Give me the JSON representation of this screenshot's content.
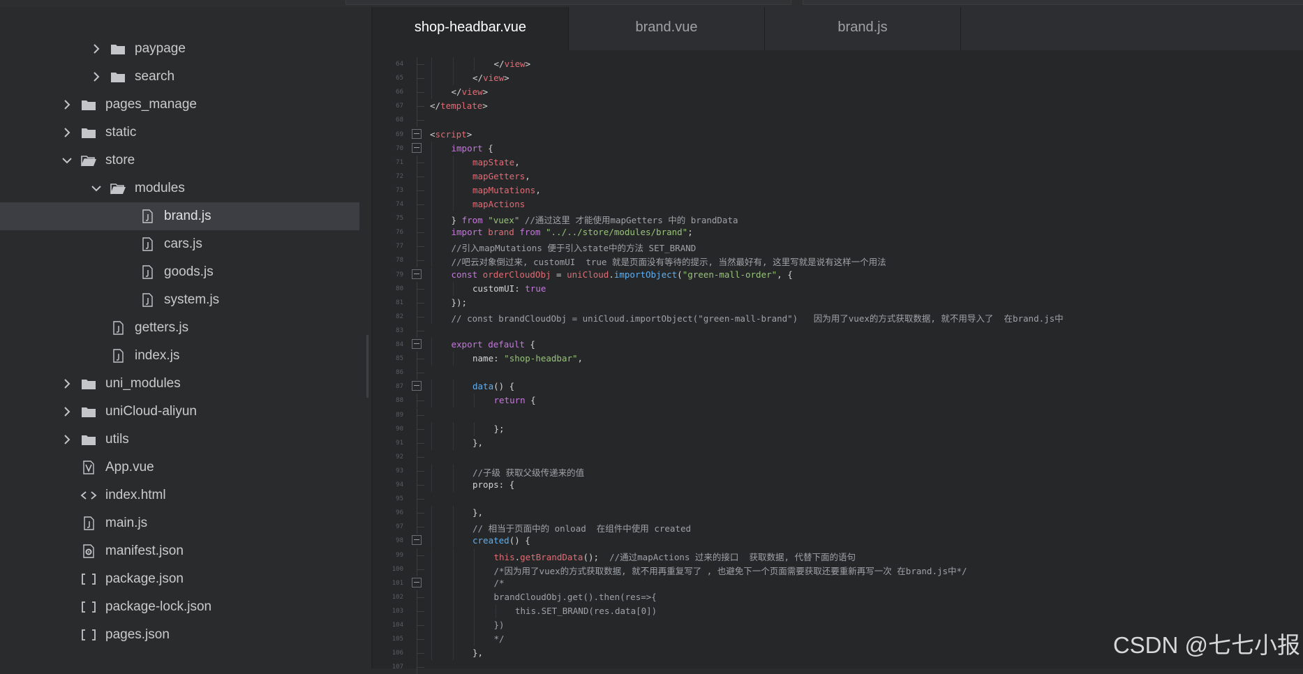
{
  "tabs": [
    {
      "label": "shop-headbar.vue",
      "active": true
    },
    {
      "label": "brand.vue",
      "active": false
    },
    {
      "label": "brand.js",
      "active": false
    }
  ],
  "tree": [
    {
      "label": "paypage",
      "type": "folder",
      "expanded": false,
      "depth": 2,
      "icon": "folder-icon"
    },
    {
      "label": "search",
      "type": "folder",
      "expanded": false,
      "depth": 2,
      "icon": "folder-icon"
    },
    {
      "label": "pages_manage",
      "type": "folder",
      "expanded": false,
      "depth": 1,
      "icon": "folder-icon"
    },
    {
      "label": "static",
      "type": "folder",
      "expanded": false,
      "depth": 1,
      "icon": "folder-icon"
    },
    {
      "label": "store",
      "type": "folder",
      "expanded": true,
      "depth": 1,
      "icon": "folder-open-icon"
    },
    {
      "label": "modules",
      "type": "folder",
      "expanded": true,
      "depth": 2,
      "icon": "folder-open-icon"
    },
    {
      "label": "brand.js",
      "type": "file",
      "depth": 3,
      "icon": "js-file-icon",
      "selected": true
    },
    {
      "label": "cars.js",
      "type": "file",
      "depth": 3,
      "icon": "js-file-icon"
    },
    {
      "label": "goods.js",
      "type": "file",
      "depth": 3,
      "icon": "js-file-icon"
    },
    {
      "label": "system.js",
      "type": "file",
      "depth": 3,
      "icon": "js-file-icon"
    },
    {
      "label": "getters.js",
      "type": "file",
      "depth": 2,
      "icon": "js-file-icon"
    },
    {
      "label": "index.js",
      "type": "file",
      "depth": 2,
      "icon": "js-file-icon"
    },
    {
      "label": "uni_modules",
      "type": "folder",
      "expanded": false,
      "depth": 1,
      "icon": "folder-icon"
    },
    {
      "label": "uniCloud-aliyun",
      "type": "folder",
      "expanded": false,
      "depth": 1,
      "icon": "folder-icon"
    },
    {
      "label": "utils",
      "type": "folder",
      "expanded": false,
      "depth": 1,
      "icon": "folder-icon"
    },
    {
      "label": "App.vue",
      "type": "file",
      "depth": 1,
      "icon": "vue-file-icon"
    },
    {
      "label": "index.html",
      "type": "file",
      "depth": 1,
      "icon": "html-file-icon"
    },
    {
      "label": "main.js",
      "type": "file",
      "depth": 1,
      "icon": "js-file-icon"
    },
    {
      "label": "manifest.json",
      "type": "file",
      "depth": 1,
      "icon": "manifest-file-icon"
    },
    {
      "label": "package.json",
      "type": "file",
      "depth": 1,
      "icon": "json-file-icon"
    },
    {
      "label": "package-lock.json",
      "type": "file",
      "depth": 1,
      "icon": "json-file-icon"
    },
    {
      "label": "pages.json",
      "type": "file",
      "depth": 1,
      "icon": "json-file-icon"
    }
  ],
  "code_lines": [
    {
      "n": "64",
      "indent": 3,
      "fold": false,
      "tokens": [
        {
          "t": "</",
          "c": "p"
        },
        {
          "t": "view",
          "c": "tag"
        },
        {
          "t": ">",
          "c": "p"
        }
      ]
    },
    {
      "n": "65",
      "indent": 2,
      "fold": false,
      "tokens": [
        {
          "t": "</",
          "c": "p"
        },
        {
          "t": "view",
          "c": "tag"
        },
        {
          "t": ">",
          "c": "p"
        }
      ]
    },
    {
      "n": "66",
      "indent": 1,
      "fold": false,
      "tokens": [
        {
          "t": "</",
          "c": "p"
        },
        {
          "t": "view",
          "c": "tag"
        },
        {
          "t": ">",
          "c": "p"
        }
      ]
    },
    {
      "n": "67",
      "indent": 0,
      "fold": false,
      "tokens": [
        {
          "t": "</",
          "c": "p"
        },
        {
          "t": "template",
          "c": "tag"
        },
        {
          "t": ">",
          "c": "p"
        }
      ]
    },
    {
      "n": "68",
      "indent": 0,
      "fold": false,
      "tokens": []
    },
    {
      "n": "69",
      "indent": 0,
      "fold": true,
      "tokens": [
        {
          "t": "<",
          "c": "p"
        },
        {
          "t": "script",
          "c": "tag"
        },
        {
          "t": ">",
          "c": "p"
        }
      ]
    },
    {
      "n": "70",
      "indent": 1,
      "fold": true,
      "tokens": [
        {
          "t": "import",
          "c": "kw"
        },
        {
          "t": " {",
          "c": "p"
        }
      ]
    },
    {
      "n": "71",
      "indent": 2,
      "fold": false,
      "tokens": [
        {
          "t": "mapState",
          "c": "var"
        },
        {
          "t": ",",
          "c": "p"
        }
      ]
    },
    {
      "n": "72",
      "indent": 2,
      "fold": false,
      "tokens": [
        {
          "t": "mapGetters",
          "c": "var"
        },
        {
          "t": ",",
          "c": "p"
        }
      ]
    },
    {
      "n": "73",
      "indent": 2,
      "fold": false,
      "tokens": [
        {
          "t": "mapMutations",
          "c": "var"
        },
        {
          "t": ",",
          "c": "p"
        }
      ]
    },
    {
      "n": "74",
      "indent": 2,
      "fold": false,
      "tokens": [
        {
          "t": "mapActions",
          "c": "var"
        }
      ]
    },
    {
      "n": "75",
      "indent": 1,
      "fold": false,
      "tokens": [
        {
          "t": "} ",
          "c": "p"
        },
        {
          "t": "from",
          "c": "kw"
        },
        {
          "t": " ",
          "c": "p"
        },
        {
          "t": "\"vuex\"",
          "c": "str"
        },
        {
          "t": " //通过这里 才能使用mapGetters 中的 brandData",
          "c": "cm"
        }
      ]
    },
    {
      "n": "76",
      "indent": 1,
      "fold": false,
      "tokens": [
        {
          "t": "import",
          "c": "kw"
        },
        {
          "t": " ",
          "c": "p"
        },
        {
          "t": "brand",
          "c": "var"
        },
        {
          "t": " ",
          "c": "p"
        },
        {
          "t": "from",
          "c": "kw"
        },
        {
          "t": " ",
          "c": "p"
        },
        {
          "t": "\"../../store/modules/brand\"",
          "c": "str"
        },
        {
          "t": ";",
          "c": "p"
        }
      ]
    },
    {
      "n": "77",
      "indent": 1,
      "fold": false,
      "tokens": [
        {
          "t": "//引入mapMutations 便于引入state中的方法 SET_BRAND",
          "c": "cm"
        }
      ]
    },
    {
      "n": "78",
      "indent": 1,
      "fold": false,
      "tokens": [
        {
          "t": "//吧云对象倒过来, customUI  true 就是页面没有等待的提示, 当然最好有, 这里写就是说有这样一个用法",
          "c": "cm"
        }
      ]
    },
    {
      "n": "79",
      "indent": 1,
      "fold": true,
      "tokens": [
        {
          "t": "const",
          "c": "kw"
        },
        {
          "t": " ",
          "c": "p"
        },
        {
          "t": "orderCloudObj",
          "c": "var"
        },
        {
          "t": " = ",
          "c": "p"
        },
        {
          "t": "uniCloud",
          "c": "var"
        },
        {
          "t": ".",
          "c": "p"
        },
        {
          "t": "importObject",
          "c": "fn"
        },
        {
          "t": "(",
          "c": "p"
        },
        {
          "t": "\"green-mall-order\"",
          "c": "str"
        },
        {
          "t": ", {",
          "c": "p"
        }
      ]
    },
    {
      "n": "80",
      "indent": 2,
      "fold": false,
      "tokens": [
        {
          "t": "customUI",
          "c": "prop"
        },
        {
          "t": ": ",
          "c": "p"
        },
        {
          "t": "true",
          "c": "kw"
        }
      ]
    },
    {
      "n": "81",
      "indent": 1,
      "fold": false,
      "tokens": [
        {
          "t": "});",
          "c": "p"
        }
      ]
    },
    {
      "n": "82",
      "indent": 1,
      "fold": false,
      "tokens": [
        {
          "t": "// const brandCloudObj = uniCloud.importObject(\"green-mall-brand\")   因为用了vuex的方式获取数据, 就不用导入了  在brand.js中",
          "c": "cm"
        }
      ]
    },
    {
      "n": "83",
      "indent": 0,
      "fold": false,
      "tokens": []
    },
    {
      "n": "84",
      "indent": 1,
      "fold": true,
      "tokens": [
        {
          "t": "export",
          "c": "kw"
        },
        {
          "t": " ",
          "c": "p"
        },
        {
          "t": "default",
          "c": "kw"
        },
        {
          "t": " {",
          "c": "p"
        }
      ]
    },
    {
      "n": "85",
      "indent": 2,
      "fold": false,
      "tokens": [
        {
          "t": "name",
          "c": "prop"
        },
        {
          "t": ": ",
          "c": "p"
        },
        {
          "t": "\"shop-headbar\"",
          "c": "str"
        },
        {
          "t": ",",
          "c": "p"
        }
      ]
    },
    {
      "n": "86",
      "indent": 0,
      "fold": false,
      "tokens": []
    },
    {
      "n": "87",
      "indent": 2,
      "fold": true,
      "tokens": [
        {
          "t": "data",
          "c": "fn"
        },
        {
          "t": "() {",
          "c": "p"
        }
      ]
    },
    {
      "n": "88",
      "indent": 3,
      "fold": false,
      "tokens": [
        {
          "t": "return",
          "c": "kw"
        },
        {
          "t": " {",
          "c": "p"
        }
      ]
    },
    {
      "n": "89",
      "indent": 0,
      "fold": false,
      "tokens": []
    },
    {
      "n": "90",
      "indent": 3,
      "fold": false,
      "tokens": [
        {
          "t": "};",
          "c": "p"
        }
      ]
    },
    {
      "n": "91",
      "indent": 2,
      "fold": false,
      "tokens": [
        {
          "t": "},",
          "c": "p"
        }
      ]
    },
    {
      "n": "92",
      "indent": 0,
      "fold": false,
      "tokens": []
    },
    {
      "n": "93",
      "indent": 2,
      "fold": false,
      "tokens": [
        {
          "t": "//子级 获取父级传递来的值",
          "c": "cm"
        }
      ]
    },
    {
      "n": "94",
      "indent": 2,
      "fold": false,
      "tokens": [
        {
          "t": "props",
          "c": "prop"
        },
        {
          "t": ": {",
          "c": "p"
        }
      ]
    },
    {
      "n": "95",
      "indent": 0,
      "fold": false,
      "tokens": []
    },
    {
      "n": "96",
      "indent": 2,
      "fold": false,
      "tokens": [
        {
          "t": "},",
          "c": "p"
        }
      ]
    },
    {
      "n": "97",
      "indent": 2,
      "fold": false,
      "tokens": [
        {
          "t": "// 相当于页面中的 onload  在组件中使用 created",
          "c": "cm"
        }
      ]
    },
    {
      "n": "98",
      "indent": 2,
      "fold": true,
      "tokens": [
        {
          "t": "created",
          "c": "fn"
        },
        {
          "t": "() {",
          "c": "p"
        }
      ]
    },
    {
      "n": "99",
      "indent": 3,
      "fold": false,
      "tokens": [
        {
          "t": "this",
          "c": "kw2"
        },
        {
          "t": ".",
          "c": "p"
        },
        {
          "t": "getBrandData",
          "c": "var"
        },
        {
          "t": "();  ",
          "c": "p"
        },
        {
          "t": "//通过mapActions 过来的接口  获取数据, 代替下面的语句",
          "c": "cm"
        }
      ]
    },
    {
      "n": "100",
      "indent": 3,
      "fold": false,
      "tokens": [
        {
          "t": "/*因为用了vuex的方式获取数据, 就不用再重复写了 , 也避免下一个页面需要获取还要重新再写一次 在brand.js中*/",
          "c": "cm"
        }
      ]
    },
    {
      "n": "101",
      "indent": 3,
      "fold": true,
      "tokens": [
        {
          "t": "/*",
          "c": "cm"
        }
      ]
    },
    {
      "n": "102",
      "indent": 3,
      "fold": false,
      "tokens": [
        {
          "t": "brandCloudObj.get().then(res=>{",
          "c": "cm"
        }
      ]
    },
    {
      "n": "103",
      "indent": 4,
      "fold": false,
      "tokens": [
        {
          "t": "this.SET_BRAND(res.data[0])",
          "c": "cm"
        }
      ]
    },
    {
      "n": "104",
      "indent": 3,
      "fold": false,
      "tokens": [
        {
          "t": "})",
          "c": "cm"
        }
      ]
    },
    {
      "n": "105",
      "indent": 3,
      "fold": false,
      "tokens": [
        {
          "t": "*/",
          "c": "cm"
        }
      ]
    },
    {
      "n": "106",
      "indent": 2,
      "fold": false,
      "tokens": [
        {
          "t": "},",
          "c": "p"
        }
      ]
    },
    {
      "n": "107",
      "indent": 0,
      "fold": false,
      "tokens": []
    }
  ],
  "colors": {
    "p": "#d4d4d4",
    "tag": "#e06c75",
    "kw": "#c678dd",
    "kw2": "#e06c75",
    "var": "#e06c75",
    "str": "#98c379",
    "cm": "#9ea3a8",
    "fn": "#61afef",
    "prop": "#d4d4d4"
  },
  "watermark": "CSDN @七七小报"
}
